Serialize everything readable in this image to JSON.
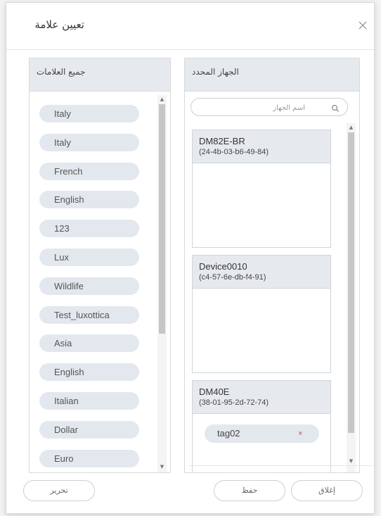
{
  "dialog": {
    "title": "تعيين علامة",
    "close_icon": "close-icon"
  },
  "left_panel": {
    "title": "جميع العلامات",
    "tags": [
      "Italy",
      "Italy",
      "French",
      "English",
      "123",
      "Lux",
      "Wildlife",
      "Test_luxottica",
      "Asia",
      "English",
      "Italian",
      "Dollar",
      "Euro"
    ]
  },
  "right_panel": {
    "title": "الجهاز المحدد",
    "search": {
      "placeholder": "اسم الجهاز",
      "icon": "search-icon"
    },
    "devices": [
      {
        "name": "DM82E-BR",
        "mac": "(24-4b-03-b6-49-84)",
        "tags": []
      },
      {
        "name": "Device0010",
        "mac": "(c4-57-6e-db-f4-91)",
        "tags": []
      },
      {
        "name": "DM40E",
        "mac": "(38-01-95-2d-72-74)",
        "tags": [
          "tag02"
        ]
      }
    ],
    "remove_tag_symbol": "×"
  },
  "footer": {
    "edit_label": "تحرير",
    "save_label": "حفظ",
    "close_label": "إغلاق"
  }
}
